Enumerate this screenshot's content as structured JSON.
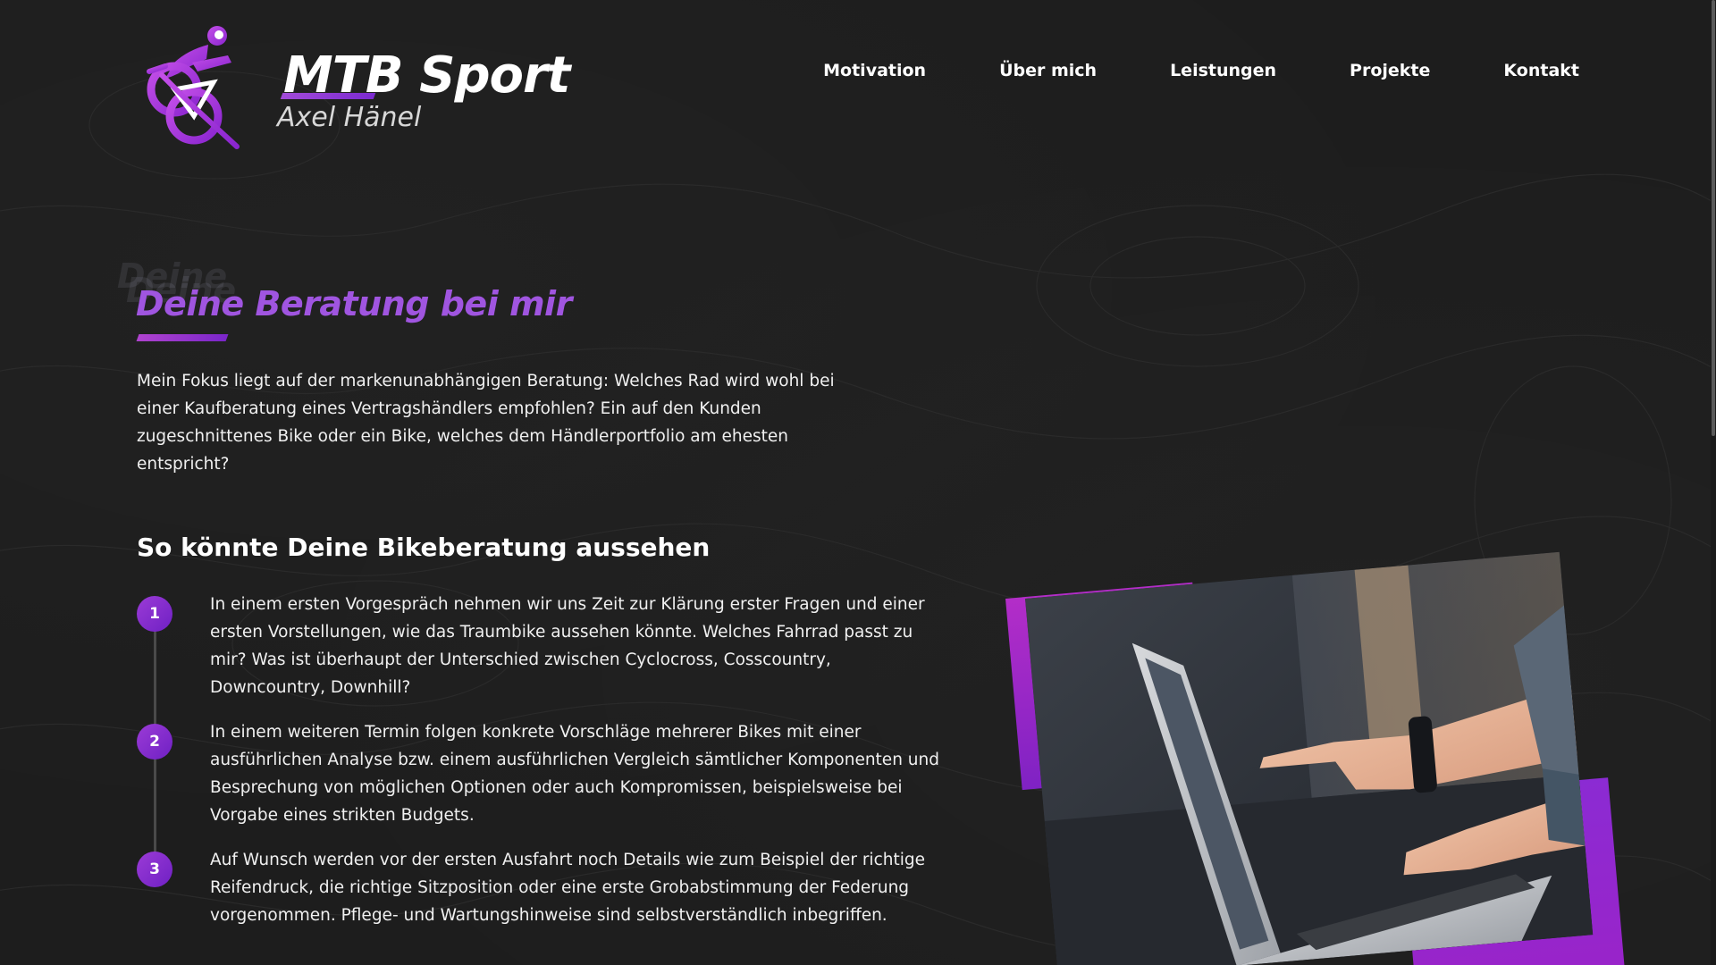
{
  "brand": {
    "title": "MTB Sport",
    "subtitle": "Axel Hänel",
    "logo_icon": "mountain-biker-icon"
  },
  "nav": {
    "items": [
      {
        "label": "Motivation"
      },
      {
        "label": "Über mich"
      },
      {
        "label": "Leistungen"
      },
      {
        "label": "Projekte"
      },
      {
        "label": "Kontakt"
      }
    ]
  },
  "section": {
    "ghost_text": "Deine",
    "title": "Deine Beratung bei mir",
    "intro": "Mein Fokus liegt auf der markenunabhängigen Beratung: Welches Rad wird wohl bei einer Kaufberatung eines Vertragshändlers empfohlen? Ein auf den Kunden zugeschnittenes Bike oder ein Bike, welches dem Händlerportfolio am ehesten entspricht?",
    "subheading": "So könnte Deine Bikeberatung aussehen",
    "steps": [
      {
        "number": "1",
        "text": "In einem ersten Vorgespräch nehmen wir uns Zeit zur Klärung erster Fragen und einer ersten Vorstellungen, wie das Traumbike aussehen könnte. Welches Fahrrad passt zu mir? Was ist überhaupt der Unterschied zwischen Cyclocross, Cosscountry, Downcountry, Downhill?"
      },
      {
        "number": "2",
        "text": "In einem weiteren Termin folgen konkrete Vorschläge mehrerer Bikes mit einer ausführlichen Analyse bzw. einem ausführlichen Vergleich sämtlicher Komponenten und Besprechung von möglichen Optionen oder auch Kompromissen, beispielsweise bei Vorgabe eines strikten Budgets."
      },
      {
        "number": "3",
        "text": "Auf Wunsch werden vor der ersten Ausfahrt noch Details wie zum Beispiel der richtige Reifendruck, die richtige Sitzposition oder eine erste Grobabstimmung der Federung vorgenommen. Pflege- und Wartungshinweise sind selbstverständlich inbegriffen."
      }
    ]
  },
  "colors": {
    "accent": "#a055e0",
    "accent_dark": "#7a26c9",
    "background": "#1d1d1d"
  }
}
